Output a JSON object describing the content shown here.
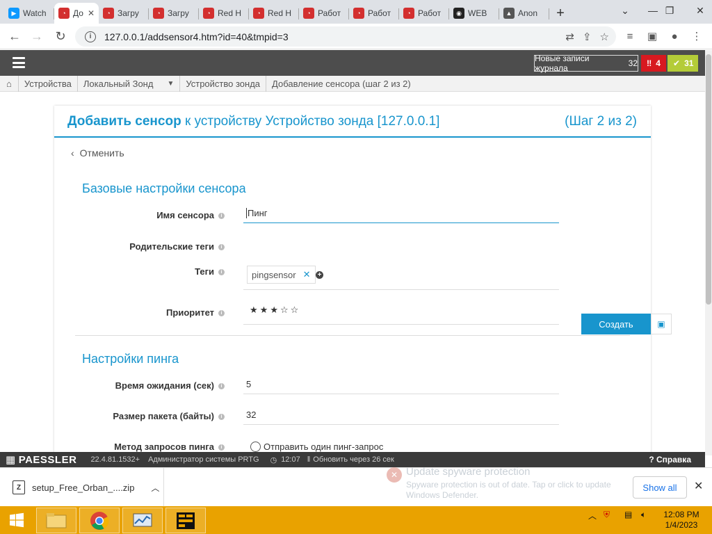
{
  "browser": {
    "tabs": [
      {
        "title": "Watch",
        "icon": "play-icon",
        "color": "#0d99ff"
      },
      {
        "title": "До",
        "icon": "prtg-logo-icon",
        "color": "#d32f2f",
        "active": true
      },
      {
        "title": "Загру",
        "icon": "prtg-logo-icon",
        "color": "#d32f2f"
      },
      {
        "title": "Загру",
        "icon": "prtg-logo-icon",
        "color": "#d32f2f"
      },
      {
        "title": "Red H",
        "icon": "prtg-logo-icon",
        "color": "#d32f2f"
      },
      {
        "title": "Red H",
        "icon": "prtg-logo-icon",
        "color": "#d32f2f"
      },
      {
        "title": "Работ",
        "icon": "prtg-logo-icon",
        "color": "#d32f2f"
      },
      {
        "title": "Работ",
        "icon": "prtg-logo-icon",
        "color": "#d32f2f"
      },
      {
        "title": "Работ",
        "icon": "prtg-logo-icon",
        "color": "#d32f2f"
      },
      {
        "title": "WEB",
        "icon": "eye-icon",
        "color": "#222222"
      },
      {
        "title": "Anon",
        "icon": "anon-icon",
        "color": "#555555"
      }
    ],
    "url": "127.0.0.1/addsensor4.htm?id=40&tmpid=3"
  },
  "prtg": {
    "log_button": "Новые записи журнала",
    "log_count": "32",
    "alarm_count": "4",
    "ok_count": "31",
    "breadcrumbs": [
      "Устройства",
      "Локальный Зонд",
      "Устройство зонда",
      "Добавление сенсора (шаг 2 из 2)"
    ],
    "title_bold": "Добавить сенсор",
    "title_rest": "к устройству Устройство зонда [127.0.0.1]",
    "step": "(Шаг 2 из 2)",
    "cancel": "Отменить",
    "section1": "Базовые настройки сенсора",
    "name_label": "Имя сенсора",
    "name_value": "Пинг",
    "parent_tags_label": "Родительские теги",
    "tags_label": "Теги",
    "tag_value": "pingsensor",
    "priority_label": "Приоритет",
    "priority_stars": 3,
    "create_button": "Создать",
    "section2": "Настройки пинга",
    "timeout_label": "Время ожидания (сек)",
    "timeout_value": "5",
    "packet_label": "Размер пакета (байты)",
    "packet_value": "32",
    "method_label": "Метод запросов пинга",
    "method_option": "Отправить один пинг-запрос"
  },
  "statusbar": {
    "brand": "PAESSLER",
    "version": "22.4.81.1532+",
    "user": "Администратор системы PRTG",
    "time": "12:07",
    "refresh": "Обновить через 26 сек",
    "help": "Справка"
  },
  "downloads": {
    "file": "setup_Free_Orban_....zip",
    "show_all": "Show all"
  },
  "notification": {
    "title": "Update spyware protection",
    "body": "Spyware protection is out of date. Tap or click to update Windows Defender."
  },
  "taskbar": {
    "time": "12:08 PM",
    "date": "1/4/2023"
  },
  "colors": {
    "accent": "#1895cd",
    "alarm": "#d71920",
    "ok": "#b4cc38",
    "taskbar": "#e9a200"
  }
}
